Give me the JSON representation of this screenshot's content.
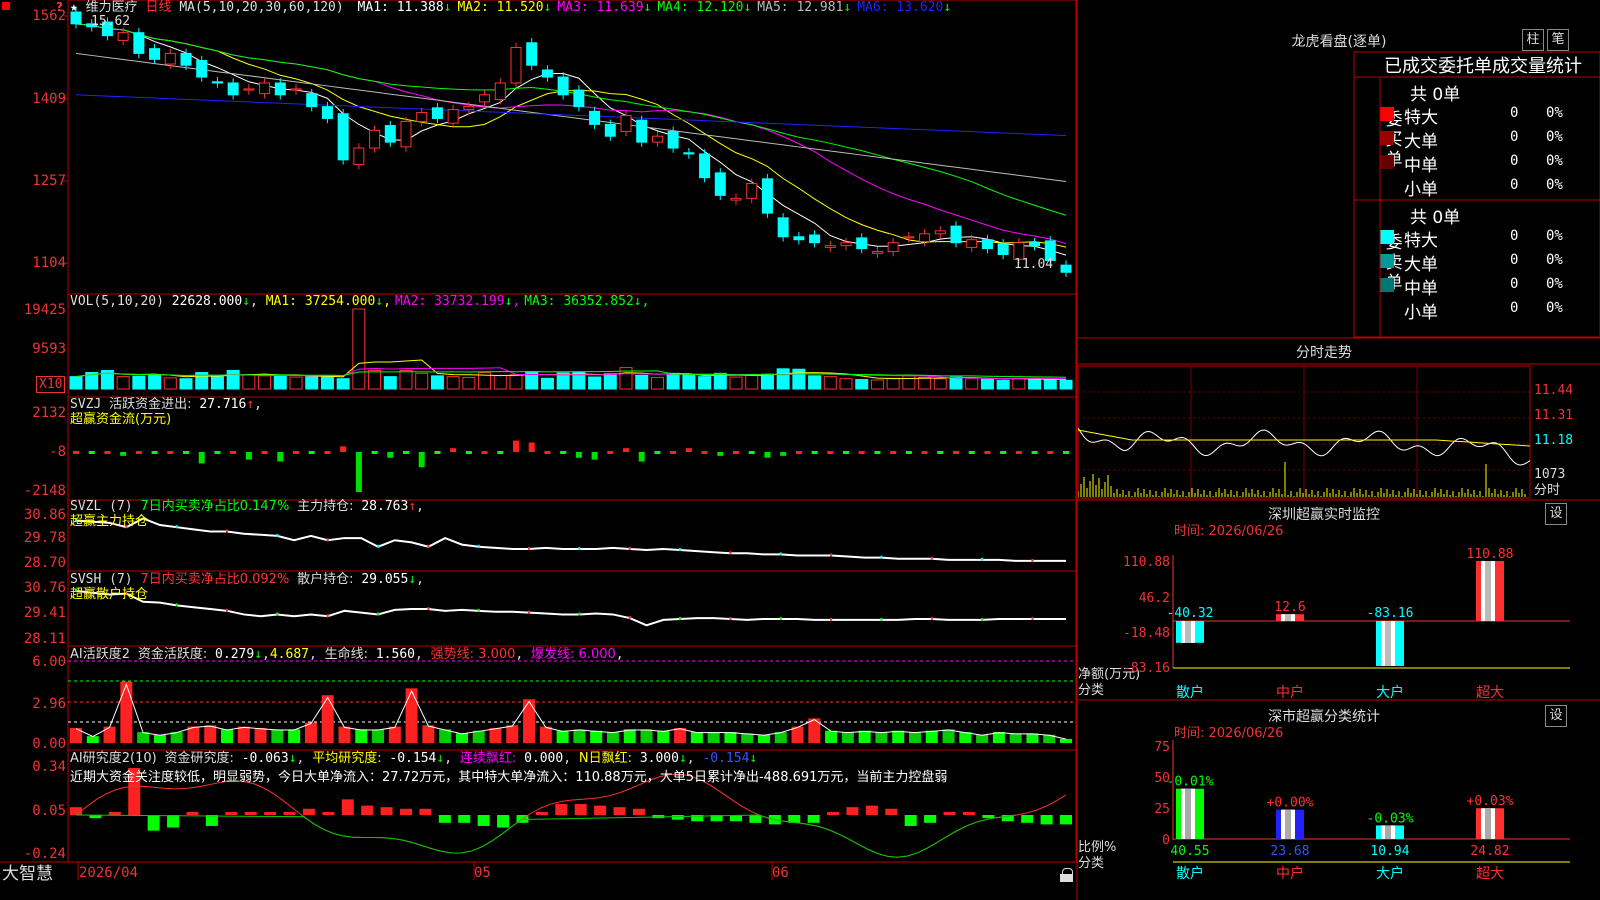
{
  "stock": {
    "name": "维力医疗",
    "period": "日线"
  },
  "main": {
    "ma_title": "MA(5,10,20,30,60,120)",
    "ma": [
      {
        "label": "MA1:",
        "value": "11.388",
        "arrow": "↓",
        "color": "#ffffff"
      },
      {
        "label": "MA2:",
        "value": "11.520",
        "arrow": "↓",
        "color": "#ffff00"
      },
      {
        "label": "MA3:",
        "value": "11.639",
        "arrow": "↓",
        "color": "#ff00ff"
      },
      {
        "label": "MA4:",
        "value": "12.120",
        "arrow": "↓",
        "color": "#00ff00"
      },
      {
        "label": "MA5:",
        "value": "12.981",
        "arrow": "↓",
        "color": "#bbbbbb"
      },
      {
        "label": "MA6:",
        "value": "13.620",
        "arrow": "↓",
        "color": "#2222ff"
      }
    ],
    "y_ticks": [
      "1562",
      "1409",
      "1257",
      "1104"
    ],
    "high_label": "15.62",
    "low_label": "11.04"
  },
  "vol": {
    "title": "VOL(5,10,20)",
    "value": "22628.000",
    "arrow": "↓",
    "ma": [
      {
        "label": "MA1:",
        "value": "37254.000",
        "arrow": "↓",
        "color": "#ffff00"
      },
      {
        "label": "MA2:",
        "value": "33732.199",
        "arrow": "↓",
        "color": "#ff00ff"
      },
      {
        "label": "MA3:",
        "value": "36352.852",
        "arrow": "↓",
        "color": "#00ff00"
      }
    ],
    "y_ticks": [
      "19425",
      "9593"
    ],
    "unit": "X10"
  },
  "svzj": {
    "title": "SVZJ",
    "label": "活跃资金进出:",
    "value": "27.716",
    "arrow": "↑",
    "subtitle": "超赢资金流(万元)",
    "y_ticks": [
      "2132",
      "-8",
      "-2148"
    ]
  },
  "svzl": {
    "title": "SVZL (7)",
    "pct_label": "7日内买卖净占比0.147%",
    "hold_label": "主力持仓:",
    "hold_value": "28.763",
    "arrow": "↑",
    "subtitle": "超赢主力持仓",
    "y_ticks": [
      "30.86",
      "29.78",
      "28.70"
    ]
  },
  "svsh": {
    "title": "SVSH (7)",
    "pct_label": "7日内买卖净占比0.092%",
    "hold_label": "散户持仓:",
    "hold_value": "29.055",
    "arrow": "↓",
    "subtitle": "超赢散户持仓",
    "y_ticks": [
      "30.76",
      "29.41",
      "28.11"
    ]
  },
  "ai1": {
    "title": "AI活跃度2",
    "fund_label": "资金活跃度:",
    "fund_value": "0.279",
    "fund_arrow": "↓",
    "v2": "4.687",
    "life_label": "生命线:",
    "life_value": "1.560",
    "strong": "强势线: 3.000",
    "burst": "爆发线: 6.000",
    "y_ticks": [
      "6.00",
      "2.96",
      "0.00"
    ]
  },
  "ai2": {
    "title": "AI研究度2(10)",
    "fund_label": "资金研究度:",
    "fund_value": "-0.063",
    "avg_label": "平均研究度:",
    "avg_value": "-0.154",
    "red_label": "连续飘红:",
    "red_value": "0.000",
    "nred_label": "N日飘红:",
    "nred_value": "3.000",
    "last": "-0.154",
    "note": "近期大资金关注度较低，明显弱势，今日大单净流入：27.72万元，其中特大单净流入：110.88万元，大单5日累计净出-488.691万元，当前主力控盘弱",
    "y_ticks": [
      "0.34",
      "0.05",
      "-0.24"
    ]
  },
  "xaxis": {
    "labels": [
      "2026/04",
      "05",
      "06"
    ]
  },
  "brand": "大智慧",
  "dragon": {
    "title": "龙虎看盘(逐单)",
    "btn1": "柱",
    "btn2": "笔",
    "header": "已成交委托单成交量统计",
    "buy": {
      "side": "委买单",
      "total": "共 0单",
      "rows": [
        {
          "name": "特大",
          "v": "0",
          "p": "0%",
          "color": "#ff0000"
        },
        {
          "name": "大单",
          "v": "0",
          "p": "0%",
          "color": "#990000"
        },
        {
          "name": "中单",
          "v": "0",
          "p": "0%",
          "color": "#660000"
        },
        {
          "name": "小单",
          "v": "0",
          "p": "0%",
          "color": ""
        }
      ]
    },
    "sell": {
      "side": "委卖单",
      "total": "共 0单",
      "rows": [
        {
          "name": "特大",
          "v": "0",
          "p": "0%",
          "color": "#00ffff"
        },
        {
          "name": "大单",
          "v": "0",
          "p": "0%",
          "color": "#009999"
        },
        {
          "name": "中单",
          "v": "0",
          "p": "0%",
          "color": "#007777"
        },
        {
          "name": "小单",
          "v": "0",
          "p": "0%",
          "color": ""
        }
      ]
    }
  },
  "minute": {
    "title": "分时走势",
    "prices": [
      "11.44",
      "11.31",
      "11.18"
    ],
    "vol": "1073",
    "unit": "分时"
  },
  "monitor": {
    "title": "深圳超赢实时监控",
    "btn": "设",
    "time": "时间: 2026/06/26",
    "ylabels": [
      "110.88",
      "46.2",
      "-18.48",
      "-83.16"
    ],
    "ylabel1": "净额(万元)",
    "ylabel2": "分类",
    "bars": [
      {
        "cat": "散户",
        "value": -40.32,
        "label": "-40.32"
      },
      {
        "cat": "中户",
        "value": 12.6,
        "label": "12.6"
      },
      {
        "cat": "大户",
        "value": -83.16,
        "label": "-83.16"
      },
      {
        "cat": "超大",
        "value": 110.88,
        "label": "110.88"
      }
    ]
  },
  "classify": {
    "title": "深市超赢分类统计",
    "btn": "设",
    "time": "时间: 2026/06/26",
    "ylabels": [
      "75",
      "50",
      "25",
      "0"
    ],
    "ylabel1": "比例%",
    "ylabel2": "分类",
    "bars": [
      {
        "cat": "散户",
        "value": 40.55,
        "label": "40.55",
        "chg": "-0.01%"
      },
      {
        "cat": "中户",
        "value": 23.68,
        "label": "23.68",
        "chg": "+0.00%"
      },
      {
        "cat": "大户",
        "value": 10.94,
        "label": "10.94",
        "chg": "-0.03%"
      },
      {
        "cat": "超大",
        "value": 24.82,
        "label": "24.82",
        "chg": "+0.03%"
      }
    ]
  },
  "chart_data": [
    {
      "type": "candlestick",
      "title": "维力医疗 日线",
      "ylim": [
        11.0,
        15.7
      ],
      "close": [
        15.5,
        15.45,
        15.3,
        15.35,
        15.0,
        14.9,
        15.0,
        14.8,
        14.6,
        14.5,
        14.3,
        14.4,
        14.5,
        14.3,
        14.4,
        14.1,
        13.9,
        13.2,
        13.4,
        13.7,
        13.5,
        13.85,
        14.0,
        13.9,
        14.05,
        14.1,
        14.3,
        14.5,
        15.1,
        14.8,
        14.6,
        14.3,
        14.1,
        13.8,
        13.6,
        13.95,
        13.5,
        13.6,
        13.4,
        13.3,
        12.9,
        12.6,
        12.55,
        12.8,
        12.3,
        11.9,
        11.85,
        11.8,
        11.75,
        11.8,
        11.7,
        11.65,
        11.8,
        11.9,
        11.95,
        12.0,
        11.8,
        11.85,
        11.7,
        11.6,
        11.8,
        11.75,
        11.5,
        11.3
      ],
      "ma_lines": [
        "MA1",
        "MA2",
        "MA3",
        "MA4",
        "MA5",
        "MA6"
      ]
    },
    {
      "type": "bar",
      "title": "VOL(5,10,20)",
      "values": [
        3000,
        4000,
        4500,
        3000,
        3100,
        3500,
        2700,
        2500,
        4000,
        3000,
        4500,
        3400,
        3200,
        3100,
        2900,
        3000,
        3300,
        2500,
        19425,
        4500,
        3000,
        4500,
        3800,
        3200,
        3000,
        2800,
        4000,
        3300,
        3500,
        4200,
        2600,
        3900,
        4100,
        2900,
        3700,
        5200,
        3300,
        2800,
        3800,
        3500,
        3000,
        3800,
        2900,
        3400,
        3600,
        4900,
        4800,
        3200,
        3000,
        2500,
        2300,
        2200,
        2600,
        3200,
        2800,
        2500,
        2900,
        2600,
        2400,
        2100,
        2600,
        2500,
        2300,
        2100
      ]
    },
    {
      "type": "bar",
      "title": "超赢资金流(万元)",
      "values": [
        0,
        0,
        0,
        -200,
        0,
        0,
        0,
        0,
        -600,
        0,
        0,
        -400,
        0,
        -500,
        0,
        0,
        0,
        300,
        -2100,
        0,
        -300,
        0,
        -800,
        0,
        200,
        0,
        0,
        0,
        600,
        500,
        0,
        0,
        -300,
        -400,
        0,
        200,
        -500,
        0,
        0,
        200,
        0,
        -200,
        0,
        0,
        -300,
        -200,
        0,
        0,
        0,
        0,
        0,
        0,
        0,
        0,
        0,
        0,
        0,
        0,
        0,
        0,
        0,
        0,
        0,
        0
      ]
    },
    {
      "type": "line",
      "title": "超赢主力持仓",
      "values": [
        30.6,
        30.55,
        30.5,
        30.3,
        30.7,
        30.4,
        30.3,
        30.2,
        30.1,
        30.1,
        30.0,
        29.95,
        29.9,
        29.7,
        29.9,
        29.7,
        29.8,
        29.8,
        29.4,
        29.7,
        29.6,
        29.4,
        29.8,
        29.5,
        29.4,
        29.35,
        29.3,
        29.3,
        29.35,
        29.3,
        29.3,
        29.3,
        29.35,
        29.3,
        29.25,
        29.3,
        29.25,
        29.2,
        29.15,
        29.1,
        29.1,
        29.05,
        29.05,
        29.0,
        29.0,
        29.0,
        28.95,
        28.9,
        28.9,
        28.85,
        28.85,
        28.85,
        28.8,
        28.8,
        28.8,
        28.8,
        28.75,
        28.75,
        28.75,
        28.75
      ]
    },
    {
      "type": "line",
      "title": "超赢散户持仓",
      "values": [
        30.6,
        30.5,
        30.4,
        30.45,
        30.0,
        29.95,
        29.8,
        29.7,
        29.6,
        29.5,
        29.3,
        29.2,
        29.3,
        29.2,
        29.3,
        29.2,
        29.5,
        29.4,
        29.3,
        29.55,
        29.6,
        29.6,
        29.5,
        29.55,
        29.5,
        29.45,
        29.45,
        29.4,
        29.35,
        29.3,
        29.3,
        29.35,
        29.3,
        29.1,
        28.7,
        29.0,
        29.05,
        29.1,
        29.1,
        29.05,
        29.0,
        29.05,
        29.05,
        29.05,
        29.0,
        29.0,
        29.0,
        29.0,
        29.0,
        29.0,
        29.05,
        29.05,
        29.0,
        29.0,
        29.0,
        29.05,
        29.05,
        29.05,
        29.05,
        29.05
      ]
    },
    {
      "type": "bar",
      "title": "AI活跃度2",
      "values": [
        1.1,
        0.5,
        1.2,
        4.5,
        0.8,
        0.6,
        0.8,
        1.2,
        1.3,
        1.0,
        1.2,
        1.1,
        1.0,
        1.0,
        1.5,
        3.5,
        1.2,
        1.0,
        1.0,
        1.2,
        4.0,
        1.3,
        1.0,
        0.7,
        0.9,
        1.1,
        1.3,
        3.2,
        1.2,
        0.9,
        1.0,
        0.9,
        0.8,
        1.0,
        1.0,
        0.9,
        1.1,
        0.8,
        0.8,
        0.8,
        0.7,
        0.6,
        0.8,
        1.2,
        1.8,
        0.9,
        0.8,
        0.9,
        0.8,
        0.9,
        0.8,
        0.9,
        1.0,
        0.8,
        0.6,
        0.8,
        0.7,
        0.7,
        0.6,
        0.3
      ]
    },
    {
      "type": "bar",
      "title": "AI研究度2",
      "values": [
        0.05,
        -0.02,
        0.02,
        0.3,
        -0.1,
        -0.08,
        0.0,
        -0.07,
        0.0,
        0.0,
        0.0,
        0.02,
        0.04,
        0.0,
        0.1,
        0.06,
        0.05,
        0.04,
        0.04,
        -0.05,
        -0.05,
        -0.07,
        -0.08,
        -0.05,
        0.0,
        0.07,
        0.07,
        0.06,
        0.05,
        0.04,
        -0.02,
        -0.03,
        -0.04,
        -0.04,
        -0.04,
        -0.05,
        -0.06,
        -0.05,
        -0.05,
        0.0,
        0.05,
        0.06,
        0.04,
        -0.07,
        -0.05,
        0.02,
        0.0,
        -0.02,
        -0.04,
        -0.05,
        -0.06,
        -0.06
      ]
    }
  ]
}
